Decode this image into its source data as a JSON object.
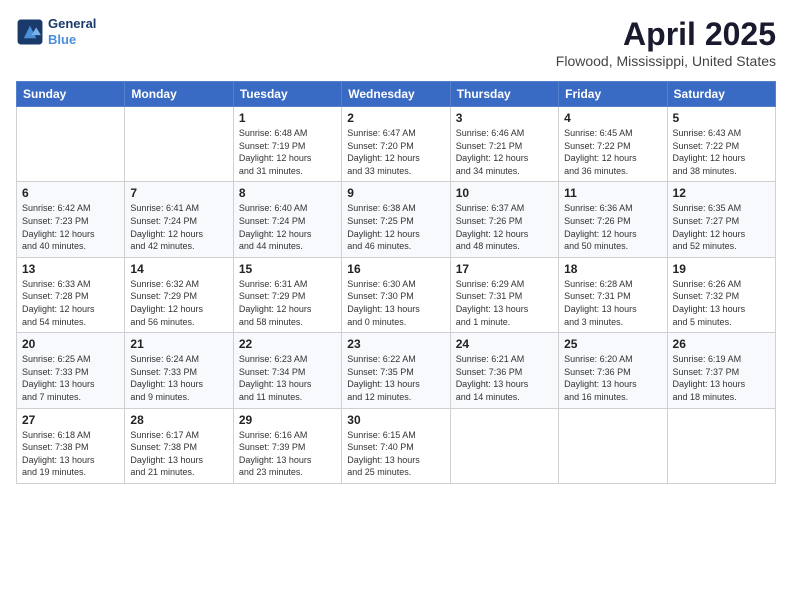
{
  "header": {
    "logo_line1": "General",
    "logo_line2": "Blue",
    "title": "April 2025",
    "subtitle": "Flowood, Mississippi, United States"
  },
  "days_of_week": [
    "Sunday",
    "Monday",
    "Tuesday",
    "Wednesday",
    "Thursday",
    "Friday",
    "Saturday"
  ],
  "weeks": [
    [
      {
        "num": "",
        "info": ""
      },
      {
        "num": "",
        "info": ""
      },
      {
        "num": "1",
        "info": "Sunrise: 6:48 AM\nSunset: 7:19 PM\nDaylight: 12 hours\nand 31 minutes."
      },
      {
        "num": "2",
        "info": "Sunrise: 6:47 AM\nSunset: 7:20 PM\nDaylight: 12 hours\nand 33 minutes."
      },
      {
        "num": "3",
        "info": "Sunrise: 6:46 AM\nSunset: 7:21 PM\nDaylight: 12 hours\nand 34 minutes."
      },
      {
        "num": "4",
        "info": "Sunrise: 6:45 AM\nSunset: 7:22 PM\nDaylight: 12 hours\nand 36 minutes."
      },
      {
        "num": "5",
        "info": "Sunrise: 6:43 AM\nSunset: 7:22 PM\nDaylight: 12 hours\nand 38 minutes."
      }
    ],
    [
      {
        "num": "6",
        "info": "Sunrise: 6:42 AM\nSunset: 7:23 PM\nDaylight: 12 hours\nand 40 minutes."
      },
      {
        "num": "7",
        "info": "Sunrise: 6:41 AM\nSunset: 7:24 PM\nDaylight: 12 hours\nand 42 minutes."
      },
      {
        "num": "8",
        "info": "Sunrise: 6:40 AM\nSunset: 7:24 PM\nDaylight: 12 hours\nand 44 minutes."
      },
      {
        "num": "9",
        "info": "Sunrise: 6:38 AM\nSunset: 7:25 PM\nDaylight: 12 hours\nand 46 minutes."
      },
      {
        "num": "10",
        "info": "Sunrise: 6:37 AM\nSunset: 7:26 PM\nDaylight: 12 hours\nand 48 minutes."
      },
      {
        "num": "11",
        "info": "Sunrise: 6:36 AM\nSunset: 7:26 PM\nDaylight: 12 hours\nand 50 minutes."
      },
      {
        "num": "12",
        "info": "Sunrise: 6:35 AM\nSunset: 7:27 PM\nDaylight: 12 hours\nand 52 minutes."
      }
    ],
    [
      {
        "num": "13",
        "info": "Sunrise: 6:33 AM\nSunset: 7:28 PM\nDaylight: 12 hours\nand 54 minutes."
      },
      {
        "num": "14",
        "info": "Sunrise: 6:32 AM\nSunset: 7:29 PM\nDaylight: 12 hours\nand 56 minutes."
      },
      {
        "num": "15",
        "info": "Sunrise: 6:31 AM\nSunset: 7:29 PM\nDaylight: 12 hours\nand 58 minutes."
      },
      {
        "num": "16",
        "info": "Sunrise: 6:30 AM\nSunset: 7:30 PM\nDaylight: 13 hours\nand 0 minutes."
      },
      {
        "num": "17",
        "info": "Sunrise: 6:29 AM\nSunset: 7:31 PM\nDaylight: 13 hours\nand 1 minute."
      },
      {
        "num": "18",
        "info": "Sunrise: 6:28 AM\nSunset: 7:31 PM\nDaylight: 13 hours\nand 3 minutes."
      },
      {
        "num": "19",
        "info": "Sunrise: 6:26 AM\nSunset: 7:32 PM\nDaylight: 13 hours\nand 5 minutes."
      }
    ],
    [
      {
        "num": "20",
        "info": "Sunrise: 6:25 AM\nSunset: 7:33 PM\nDaylight: 13 hours\nand 7 minutes."
      },
      {
        "num": "21",
        "info": "Sunrise: 6:24 AM\nSunset: 7:33 PM\nDaylight: 13 hours\nand 9 minutes."
      },
      {
        "num": "22",
        "info": "Sunrise: 6:23 AM\nSunset: 7:34 PM\nDaylight: 13 hours\nand 11 minutes."
      },
      {
        "num": "23",
        "info": "Sunrise: 6:22 AM\nSunset: 7:35 PM\nDaylight: 13 hours\nand 12 minutes."
      },
      {
        "num": "24",
        "info": "Sunrise: 6:21 AM\nSunset: 7:36 PM\nDaylight: 13 hours\nand 14 minutes."
      },
      {
        "num": "25",
        "info": "Sunrise: 6:20 AM\nSunset: 7:36 PM\nDaylight: 13 hours\nand 16 minutes."
      },
      {
        "num": "26",
        "info": "Sunrise: 6:19 AM\nSunset: 7:37 PM\nDaylight: 13 hours\nand 18 minutes."
      }
    ],
    [
      {
        "num": "27",
        "info": "Sunrise: 6:18 AM\nSunset: 7:38 PM\nDaylight: 13 hours\nand 19 minutes."
      },
      {
        "num": "28",
        "info": "Sunrise: 6:17 AM\nSunset: 7:38 PM\nDaylight: 13 hours\nand 21 minutes."
      },
      {
        "num": "29",
        "info": "Sunrise: 6:16 AM\nSunset: 7:39 PM\nDaylight: 13 hours\nand 23 minutes."
      },
      {
        "num": "30",
        "info": "Sunrise: 6:15 AM\nSunset: 7:40 PM\nDaylight: 13 hours\nand 25 minutes."
      },
      {
        "num": "",
        "info": ""
      },
      {
        "num": "",
        "info": ""
      },
      {
        "num": "",
        "info": ""
      }
    ]
  ]
}
